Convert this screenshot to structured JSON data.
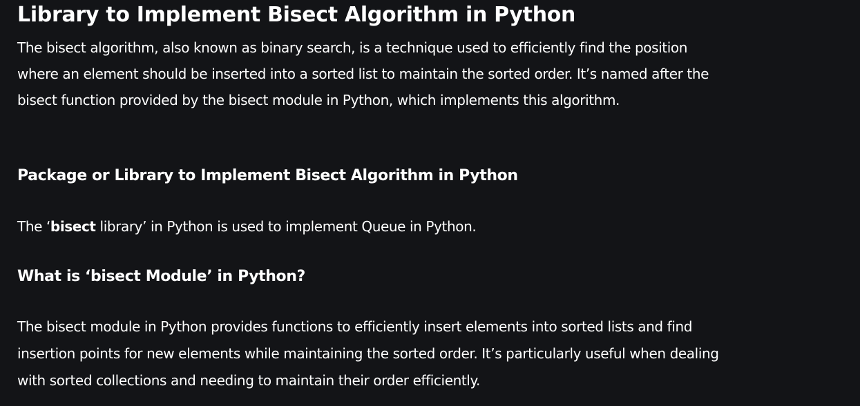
{
  "article": {
    "title": "Library to Implement Bisect Algorithm in Python",
    "intro": "The bisect algorithm, also known as binary search, is a technique used to efficiently find the position where an element should be inserted into a sorted list to maintain the sorted order. It’s named after the bisect function provided by the bisect module in Python, which implements this algorithm.",
    "package_heading": "Package or Library to Implement Bisect Algorithm in Python",
    "library_line": {
      "prefix": "The ‘",
      "bold": "bisect",
      "suffix": " library’ in Python is used to implement Queue in Python."
    },
    "module_heading": "What is ‘bisect Module’ in Python?",
    "module_description": "The bisect module in Python provides functions to efficiently insert elements into sorted lists and find insertion points for new elements while maintaining the sorted order. It’s particularly useful when dealing with sorted collections and needing to maintain their order efficiently."
  },
  "colors": {
    "background": "#131417",
    "text": "#ffffff"
  }
}
